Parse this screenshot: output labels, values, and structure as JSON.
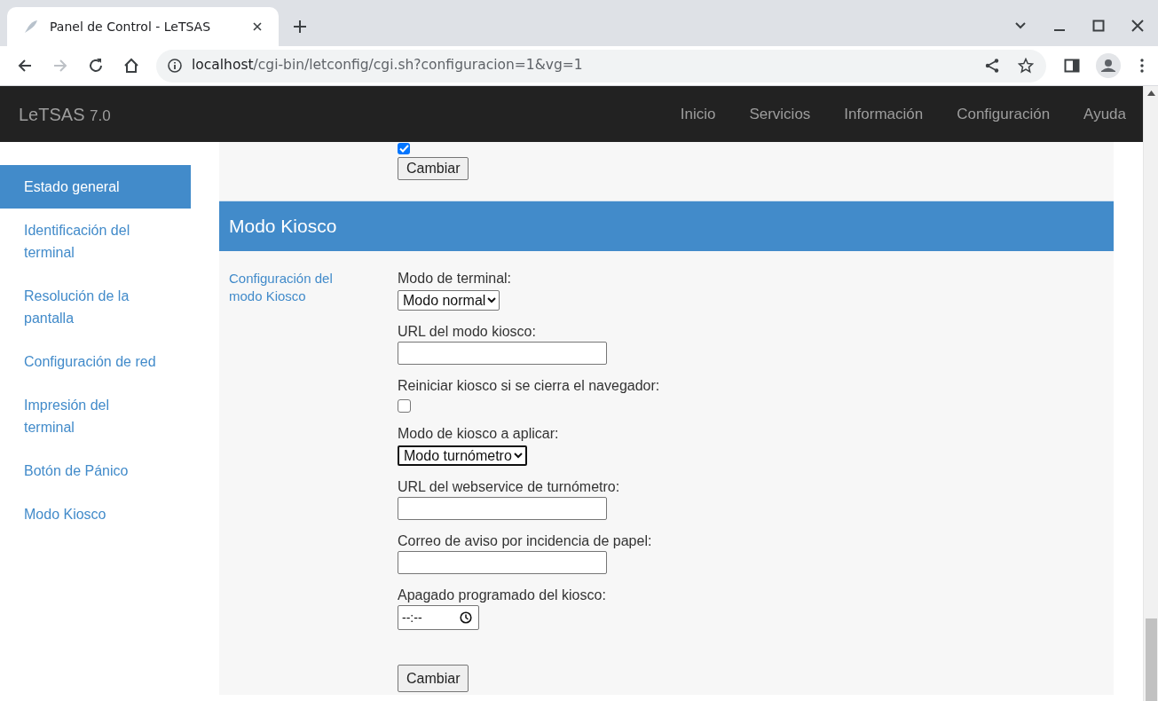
{
  "browser": {
    "tab_title": "Panel de Control - LeTSAS",
    "url_host": "localhost",
    "url_path": "/cgi-bin/letconfig/cgi.sh?configuracion=1&vg=1"
  },
  "navbar": {
    "brand": "LeTSAS",
    "version": "7.0",
    "items": [
      "Inicio",
      "Servicios",
      "Información",
      "Configuración",
      "Ayuda"
    ]
  },
  "sidebar": {
    "items": [
      {
        "label": "Estado general",
        "selected": true
      },
      {
        "label": "Identificación del terminal",
        "selected": false
      },
      {
        "label": "Resolución de la pantalla",
        "selected": false
      },
      {
        "label": "Configuración de red",
        "selected": false
      },
      {
        "label": "Impresión del terminal",
        "selected": false
      },
      {
        "label": "Botón de Pánico",
        "selected": false
      },
      {
        "label": "Modo Kiosco",
        "selected": false
      }
    ]
  },
  "panic_section": {
    "checked": true,
    "button": "Cambiar"
  },
  "kiosk_section": {
    "title": "Modo Kiosco",
    "label": "Configuración del modo Kiosco",
    "fields": [
      {
        "kind": "select",
        "label": "Modo de terminal:",
        "value": "Modo normal",
        "focused": false
      },
      {
        "kind": "text",
        "label": "URL del modo kiosco:"
      },
      {
        "kind": "checkbox",
        "label": "Reiniciar kiosco si se cierra el navegador:",
        "checked": false
      },
      {
        "kind": "select",
        "label": "Modo de kiosco a aplicar:",
        "value": "Modo turnómetro",
        "focused": true
      },
      {
        "kind": "text",
        "label": "URL del webservice de turnómetro:"
      },
      {
        "kind": "text",
        "label": "Correo de aviso por incidencia de papel:"
      },
      {
        "kind": "time",
        "label": "Apagado programado del kiosco:",
        "value": "--:--"
      }
    ],
    "button": "Cambiar"
  }
}
